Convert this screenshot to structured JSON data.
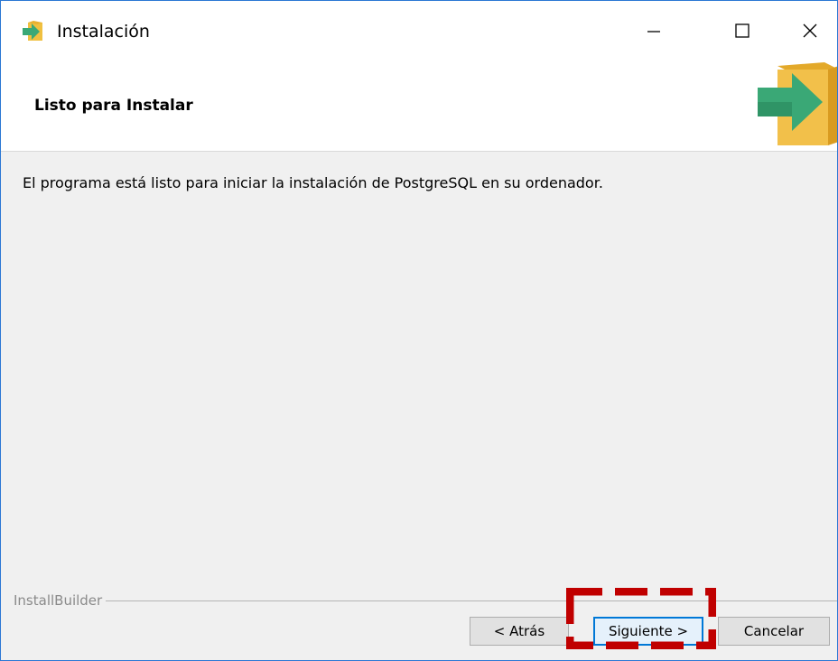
{
  "window": {
    "title": "Instalación",
    "controls": {
      "minimize": "minimize-icon",
      "maximize": "maximize-icon",
      "close": "close-icon"
    }
  },
  "header": {
    "title": "Listo para Instalar",
    "icon": "install-box-arrow-icon"
  },
  "content": {
    "message": "El programa está listo para iniciar la instalación de PostgreSQL en su ordenador."
  },
  "footer": {
    "brand": "InstallBuilder",
    "buttons": {
      "back": "< Atrás",
      "next": "Siguiente >",
      "cancel": "Cancelar"
    }
  },
  "colors": {
    "window_border": "#2b78d4",
    "highlight": "#c00000",
    "default_button_border": "#0078d7",
    "arrow_green": "#3aa876",
    "box_yellow": "#f0c040"
  }
}
